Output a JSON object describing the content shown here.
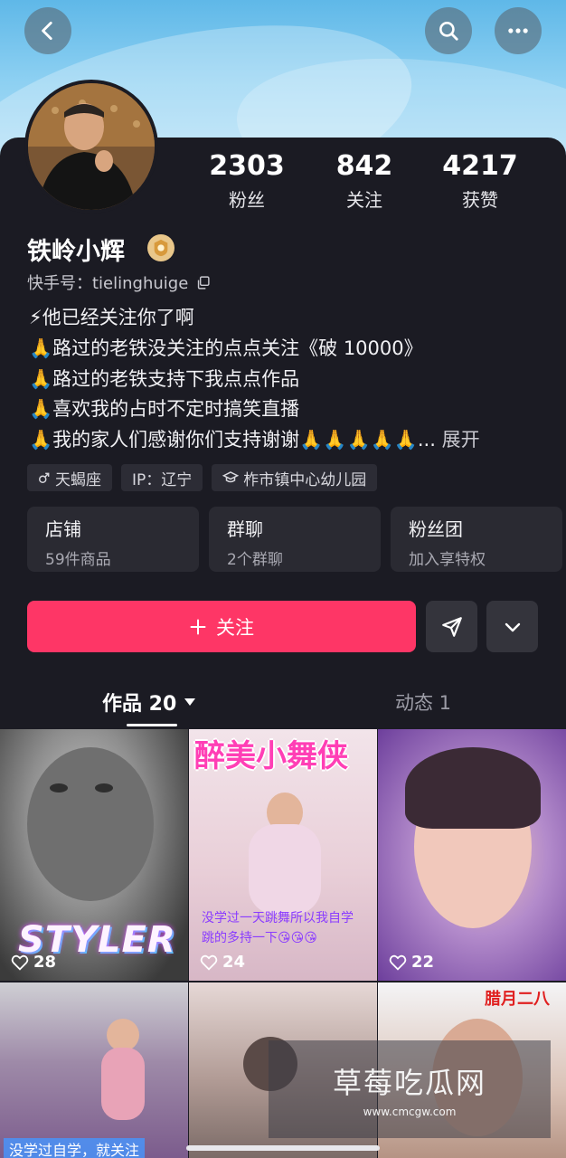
{
  "header": {
    "back_icon": "chevron-left-icon",
    "search_icon": "search-icon",
    "more_icon": "more-horizontal-icon"
  },
  "profile": {
    "name": "铁岭小辉",
    "kuaishou_id": "快手号：tielinghuige",
    "bio": [
      "⚡他已经关注你了啊",
      "🙏路过的老铁没关注的点点关注《破 10000》",
      "🙏路过的老铁支持下我点点作品",
      "🙏喜欢我的占时不定时搞笑直播",
      "🙏我的家人们感谢你们支持谢谢🙏🙏🙏🙏🙏..."
    ],
    "expand_label": "展开"
  },
  "stats": [
    {
      "value": "2303",
      "label": "粉丝"
    },
    {
      "value": "842",
      "label": "关注"
    },
    {
      "value": "4217",
      "label": "获赞"
    }
  ],
  "tags": [
    {
      "icon": "male-icon",
      "label": "天蝎座"
    },
    {
      "icon": "",
      "label": "IP：辽宁"
    },
    {
      "icon": "school-icon",
      "label": "柞市镇中心幼儿园"
    }
  ],
  "cards": [
    {
      "title": "店铺",
      "sub": "59件商品"
    },
    {
      "title": "群聊",
      "sub": "2个群聊"
    },
    {
      "title": "粉丝团",
      "sub": "加入享特权"
    }
  ],
  "actions": {
    "follow_label": "关注",
    "follow_icon": "plus-icon",
    "share_icon": "send-icon",
    "expand_icon": "chevron-down-icon"
  },
  "tabs": {
    "works": "作品 20",
    "moments": "动态 1"
  },
  "videos": [
    {
      "likes": "28",
      "overlay": "STYLER"
    },
    {
      "likes": "24",
      "overlay": "醉美小舞侠",
      "caption": "没学过一天跳舞所以我自学跳的多持一下😘😘😘"
    },
    {
      "likes": "22"
    },
    {
      "caption": "没学过自学，就关注"
    },
    {},
    {
      "overlay": "腊月二八"
    }
  ],
  "watermark": {
    "title": "草莓吃瓜网",
    "url": "www.cmcgw.com"
  },
  "colors": {
    "accent": "#fe3666",
    "panel": "#1b1b23"
  }
}
